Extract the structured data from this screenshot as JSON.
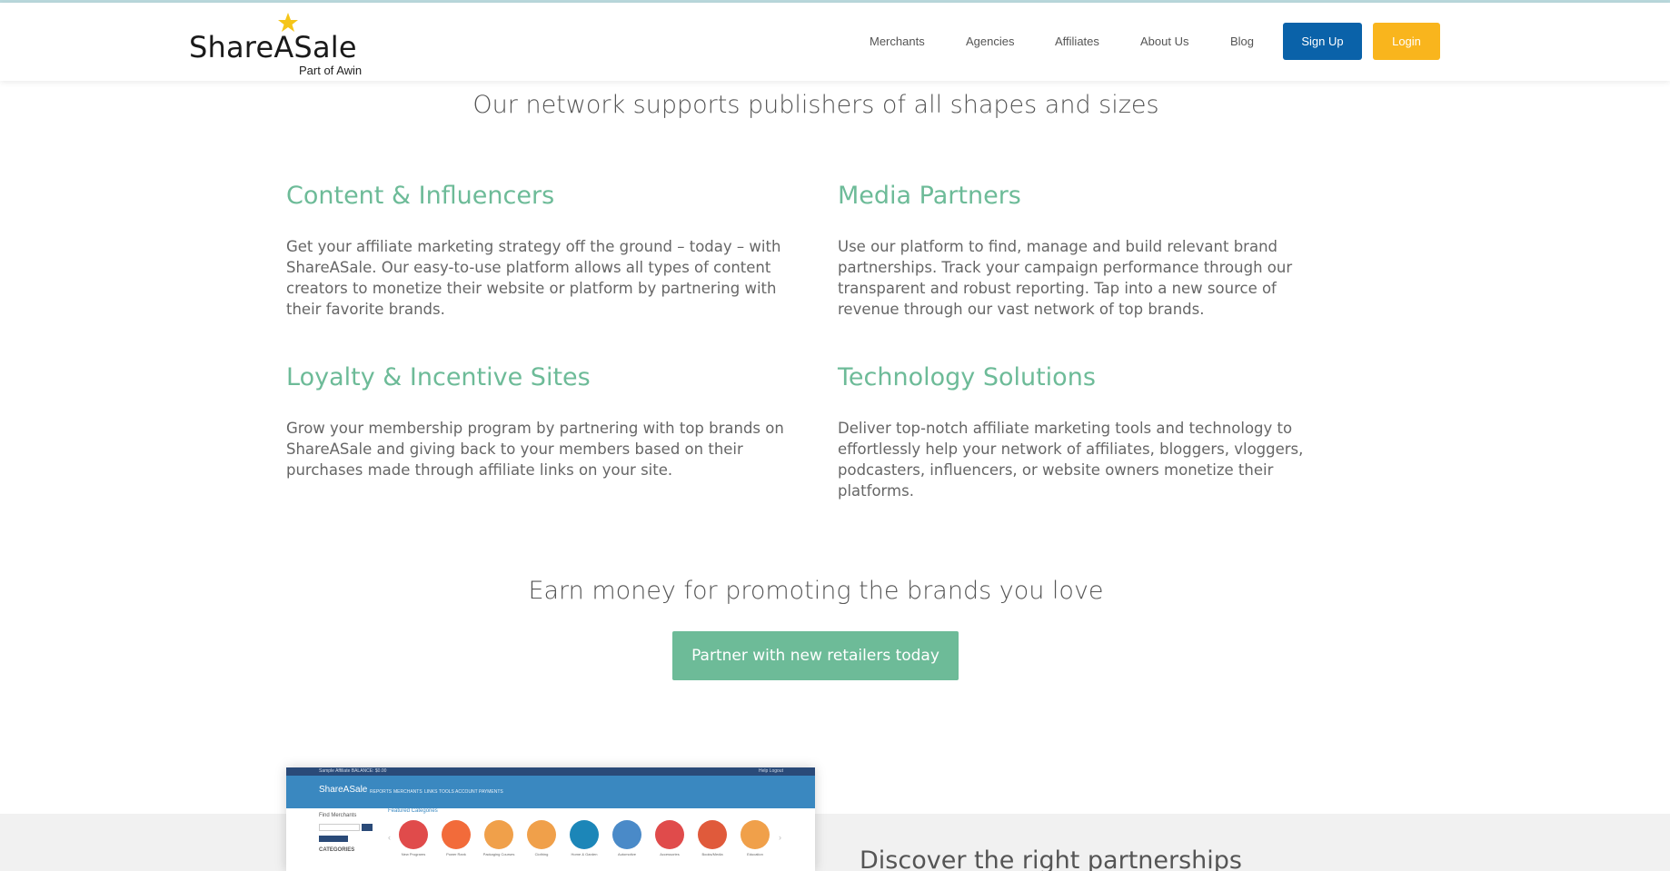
{
  "header": {
    "logo_word": "ShareASale",
    "logo_sub": "Part of Awin",
    "menu": [
      "Merchants",
      "Agencies",
      "Affiliates",
      "About Us",
      "Blog"
    ],
    "signup_label": "Sign Up",
    "login_label": "Login"
  },
  "network": {
    "title": "Our network supports publishers of all shapes and sizes",
    "cards": [
      {
        "title": "Content & Influencers",
        "text": "Get your affiliate marketing strategy off the ground – today – with ShareASale. Our easy-to-use platform allows all types of content creators to monetize their website or platform by partnering with their favorite brands."
      },
      {
        "title": "Media Partners",
        "text": "Use our platform to find, manage and build relevant brand partnerships. Track your campaign performance through our transparent and robust reporting. Tap into a new source of revenue through our vast network of top brands."
      },
      {
        "title": "Loyalty & Incentive Sites",
        "text": "Grow your membership program by partnering with top brands on ShareASale and giving back to your members based on their purchases made through affiliate links on your site."
      },
      {
        "title": "Technology Solutions",
        "text": "Deliver top-notch affiliate marketing tools and technology to effortlessly help your network of affiliates, bloggers, vloggers, podcasters, influencers, or website owners monetize their platforms."
      }
    ]
  },
  "earn": {
    "title": "Earn money for promoting the brands you love",
    "cta_label": "Partner with new retailers today"
  },
  "discover": {
    "title": "Discover the right partnerships"
  },
  "screenshot": {
    "top_left": "Sample Affiliate  BALANCE: $0.00",
    "top_right": "Help   Logout",
    "logo": "ShareASale",
    "nav": [
      "REPORTS",
      "MERCHANTS",
      "LINKS",
      "TOOLS",
      "ACCOUNT",
      "PAYMENTS"
    ],
    "find_merchants": "Find Merchants",
    "categories": "CATEGORIES",
    "featured": "Featured Categories",
    "category_labels": [
      "New Programs",
      "Power Rank",
      "Packaging Courses",
      "Clothing",
      "Home & Garden",
      "Automotive",
      "Accessories",
      "Books/Media",
      "Education"
    ]
  },
  "colors": {
    "accent_green": "#6dbb98",
    "signup_blue": "#0a62a9",
    "login_yellow": "#f9b51d",
    "star_yellow": "#f5c518"
  }
}
